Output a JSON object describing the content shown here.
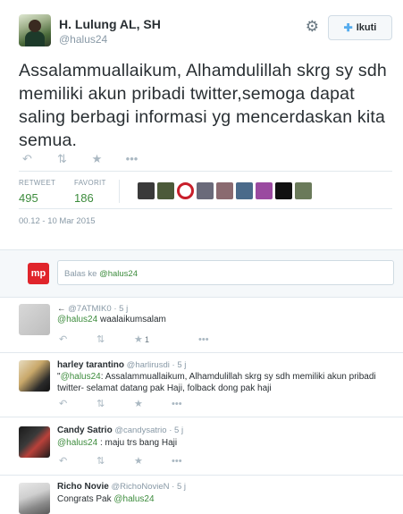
{
  "header": {
    "fullname": "H. Lulung AL, SH",
    "username": "@halus24",
    "follow_label": "Ikuti"
  },
  "tweet": {
    "text": "Assalammuallaikum, Alhamdulillah skrg sy sdh memiliki akun pribadi twitter,semoga dapat saling berbagi informasi yg mencerdaskan kita semua.",
    "retweet_label": "RETWEET",
    "retweet_count": "495",
    "favorite_label": "FAVORIT",
    "favorite_count": "186",
    "timestamp": "00.12 - 10 Mar 2015"
  },
  "favoriters": [
    "#3a3a3a",
    "#4c5a3a",
    "#c81e2a",
    "#6a6a7a",
    "#8a6a70",
    "#4a6a8a",
    "#9a4aa0",
    "#111111",
    "#6a7a5a"
  ],
  "reply_box": {
    "logo_text": "mp",
    "placeholder_prefix": "Balas ke ",
    "placeholder_handle": "@halus24"
  },
  "replies": [
    {
      "name": "",
      "prefix": "←",
      "handle": "@7ATMIK0",
      "time": "5 j",
      "mention": "@halus24",
      "text": " waalaikumsalam",
      "fav_count": "1"
    },
    {
      "name": "harley tarantino",
      "handle": "@harlirusdi",
      "time": "5 j",
      "mention": "@halus24",
      "text_prefix": "\"",
      "text": ": Assalammuallaikum, Alhamdulillah skrg sy sdh memiliki akun pribadi twitter- selamat datang pak Haji, folback dong pak haji"
    },
    {
      "name": "Candy Satrio",
      "handle": "@candysatrio",
      "time": "5 j",
      "mention": "@halus24",
      "text": " : maju trs bang Haji"
    },
    {
      "name": "Richo Novie",
      "handle": "@RichoNovieN",
      "time": "5 j",
      "text_prefix": "Congrats Pak ",
      "mention": "@halus24"
    }
  ],
  "colors": {
    "link": "#3d8c3d",
    "muted": "#8899a6",
    "follow_icon": "#55acee",
    "brand_red": "#e0252b"
  }
}
